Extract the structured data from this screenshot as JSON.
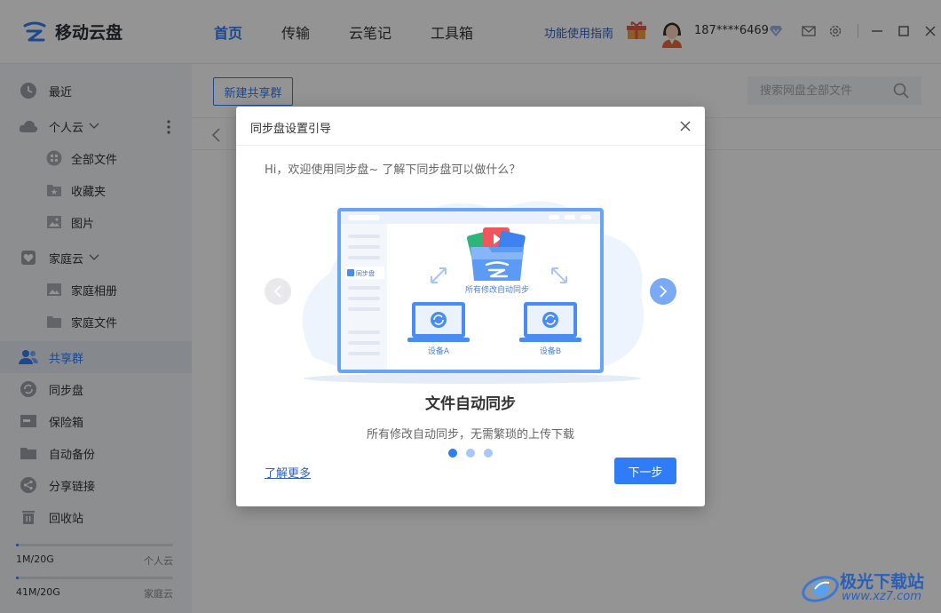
{
  "app": {
    "name": "移动云盘"
  },
  "nav": {
    "items": [
      "首页",
      "传输",
      "云笔记",
      "工具箱"
    ],
    "active": 0
  },
  "header": {
    "guide": "功能使用指南",
    "phone": "187****6469"
  },
  "sidebar": {
    "recent": "最近",
    "personal_cloud": "个人云",
    "all_files": "全部文件",
    "favorites": "收藏夹",
    "photos": "图片",
    "family_cloud": "家庭云",
    "family_album": "家庭相册",
    "family_files": "家庭文件",
    "share_group": "共享群",
    "sync_disk": "同步盘",
    "safe_box": "保险箱",
    "auto_backup": "自动备份",
    "share_link": "分享链接",
    "recycle": "回收站",
    "storage": [
      {
        "used": "1M/20G",
        "label": "个人云",
        "fraction": 0.0001
      },
      {
        "used": "41M/20G",
        "label": "家庭云",
        "fraction": 0.002
      }
    ]
  },
  "main": {
    "new_group_button": "新建共享群",
    "search_placeholder": "搜索网盘全部文件"
  },
  "dialog": {
    "title": "同步盘设置引导",
    "intro": "Hi，欢迎使用同步盘~ 了解下同步盘可以做什么？",
    "illus_sync_label": "所有修改自动同步",
    "illus_sidebar_label": "同步盘",
    "illus_device_a": "设备A",
    "illus_device_b": "设备B",
    "feature_title": "文件自动同步",
    "feature_desc": "所有修改自动同步，无需繁琐的上传下载",
    "learn_more": "了解更多",
    "next_button": "下一步",
    "page_index": 1,
    "page_count": 3
  },
  "watermark": {
    "name": "极光下载站",
    "url": "www.xz7.com"
  },
  "colors": {
    "accent": "#2f7cf6",
    "sidebar_bg": "#f3f4f6",
    "overlay": "rgba(0,0,0,0.42)"
  }
}
